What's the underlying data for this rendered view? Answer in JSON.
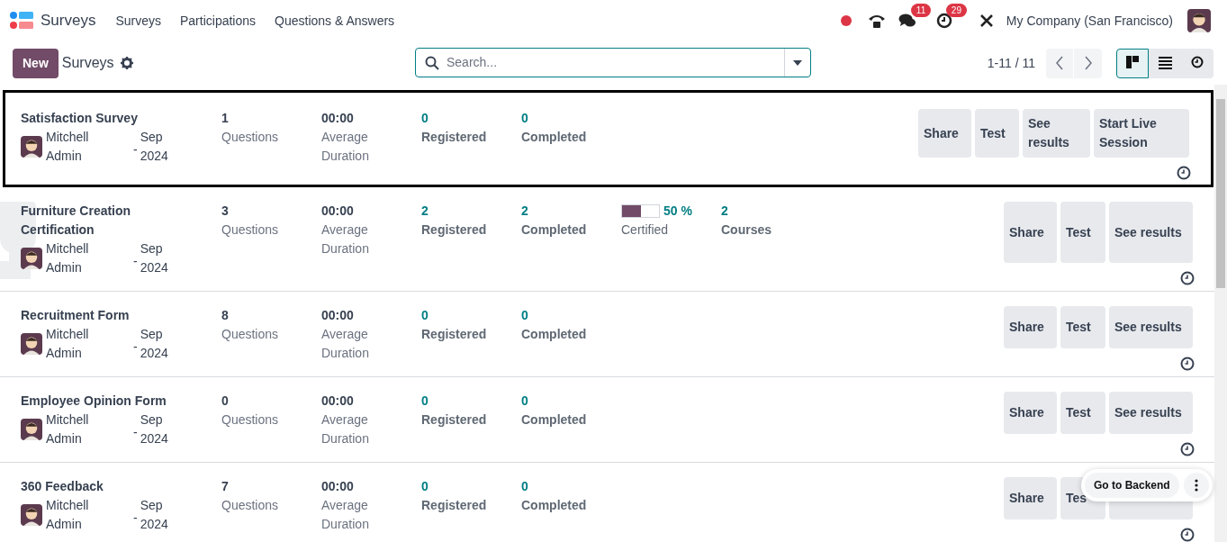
{
  "app": {
    "name": "Surveys"
  },
  "menu": [
    {
      "label": "Surveys"
    },
    {
      "label": "Participations"
    },
    {
      "label": "Questions & Answers"
    }
  ],
  "systray": {
    "chat_count": "11",
    "activity_count": "29",
    "company": "My Company (San Francisco)"
  },
  "control_panel": {
    "new_button": "New",
    "title": "Surveys",
    "search": {
      "placeholder": "Search..."
    },
    "pager": "1-11 / 11",
    "views": [
      {
        "kind": "kanban",
        "selected": true
      },
      {
        "kind": "list",
        "selected": false
      },
      {
        "kind": "activity",
        "selected": false
      }
    ]
  },
  "surveys": [
    {
      "title": "Satisfaction Survey",
      "selected": true,
      "certification": false,
      "owner": "Mitchell Admin",
      "date_separator": "-",
      "date": "Sep 2024",
      "stats": [
        {
          "kind": "count",
          "value": "1",
          "label": "Questions"
        },
        {
          "kind": "count",
          "value": "00:00",
          "label": "Average Duration"
        },
        {
          "kind": "link",
          "value": "0",
          "label": "Registered"
        },
        {
          "kind": "link",
          "value": "0",
          "label": "Completed"
        }
      ],
      "buttons": [
        "Share",
        "Test",
        "See results",
        "Start Live Session"
      ]
    },
    {
      "title": "Furniture Creation Certification",
      "selected": false,
      "certification": true,
      "owner": "Mitchell Admin",
      "date_separator": "-",
      "date": "Sep 2024",
      "stats": [
        {
          "kind": "count",
          "value": "3",
          "label": "Questions"
        },
        {
          "kind": "count",
          "value": "00:00",
          "label": "Average Duration"
        },
        {
          "kind": "link",
          "value": "2",
          "label": "Registered"
        },
        {
          "kind": "link",
          "value": "2",
          "label": "Completed"
        },
        {
          "kind": "progress",
          "level": 0.5,
          "value": "50 %",
          "label": "Certified"
        },
        {
          "kind": "link",
          "value": "2",
          "label": "Courses"
        }
      ],
      "buttons": [
        "Share",
        "Test",
        "See results"
      ]
    },
    {
      "title": "Recruitment Form",
      "selected": false,
      "certification": false,
      "owner": "Mitchell Admin",
      "date_separator": "-",
      "date": "Sep 2024",
      "stats": [
        {
          "kind": "count",
          "value": "8",
          "label": "Questions"
        },
        {
          "kind": "count",
          "value": "00:00",
          "label": "Average Duration"
        },
        {
          "kind": "link",
          "value": "0",
          "label": "Registered"
        },
        {
          "kind": "link",
          "value": "0",
          "label": "Completed"
        }
      ],
      "buttons": [
        "Share",
        "Test",
        "See results"
      ]
    },
    {
      "title": "Employee Opinion Form",
      "selected": false,
      "certification": false,
      "owner": "Mitchell Admin",
      "date_separator": "-",
      "date": "Sep 2024",
      "stats": [
        {
          "kind": "count",
          "value": "0",
          "label": "Questions"
        },
        {
          "kind": "count",
          "value": "00:00",
          "label": "Average Duration"
        },
        {
          "kind": "link",
          "value": "0",
          "label": "Registered"
        },
        {
          "kind": "link",
          "value": "0",
          "label": "Completed"
        }
      ],
      "buttons": [
        "Share",
        "Test",
        "See results"
      ]
    },
    {
      "title": "360 Feedback",
      "selected": false,
      "certification": false,
      "covered_button": true,
      "owner": "Mitchell Admin",
      "date_separator": "-",
      "date": "Sep 2024",
      "stats": [
        {
          "kind": "count",
          "value": "7",
          "label": "Questions"
        },
        {
          "kind": "count",
          "value": "00:00",
          "label": "Average Duration"
        },
        {
          "kind": "link",
          "value": "0",
          "label": "Registered"
        },
        {
          "kind": "link",
          "value": "0",
          "label": "Completed"
        }
      ],
      "buttons": [
        "Share",
        "Tes"
      ]
    }
  ],
  "floating": {
    "button": "Go to Backend"
  }
}
